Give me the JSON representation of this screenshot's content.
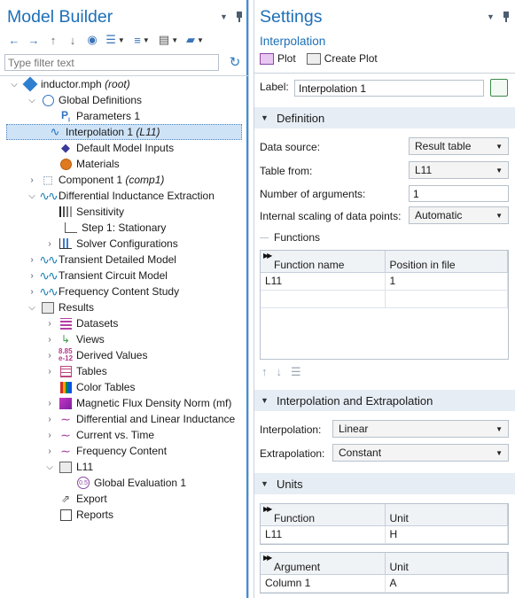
{
  "model_builder": {
    "title": "Model Builder",
    "filter_placeholder": "Type filter text",
    "tree": [
      {
        "label": "inductor.mph",
        "tag": "(root)",
        "icon": "model-root-icon"
      },
      {
        "label": "Global Definitions",
        "icon": "global-definitions-icon"
      },
      {
        "label": "Parameters 1",
        "icon": "parameters-icon"
      },
      {
        "label": "Interpolation 1",
        "tag": "(L11)",
        "icon": "interpolation-icon",
        "selected": true
      },
      {
        "label": "Default Model Inputs",
        "icon": "default-model-inputs-icon"
      },
      {
        "label": "Materials",
        "icon": "materials-icon"
      },
      {
        "label": "Component 1",
        "tag": "(comp1)",
        "icon": "component-icon"
      },
      {
        "label": "Differential Inductance Extraction",
        "icon": "study-icon"
      },
      {
        "label": "Sensitivity",
        "icon": "sensitivity-icon"
      },
      {
        "label": "Step 1: Stationary",
        "icon": "stationary-step-icon"
      },
      {
        "label": "Solver Configurations",
        "icon": "solver-configurations-icon"
      },
      {
        "label": "Transient Detailed Model",
        "icon": "study-icon"
      },
      {
        "label": "Transient Circuit Model",
        "icon": "study-icon"
      },
      {
        "label": "Frequency Content Study",
        "icon": "study-icon"
      },
      {
        "label": "Results",
        "icon": "results-icon"
      },
      {
        "label": "Datasets",
        "icon": "datasets-icon"
      },
      {
        "label": "Views",
        "icon": "views-icon"
      },
      {
        "label": "Derived Values",
        "icon": "derived-values-icon"
      },
      {
        "label": "Tables",
        "icon": "tables-icon"
      },
      {
        "label": "Color Tables",
        "icon": "color-tables-icon"
      },
      {
        "label": "Magnetic Flux Density Norm (mf)",
        "icon": "plot-group-icon"
      },
      {
        "label": "Differential and Linear Inductance",
        "icon": "1d-plot-icon"
      },
      {
        "label": "Current vs. Time",
        "icon": "1d-plot-icon"
      },
      {
        "label": "Frequency Content",
        "icon": "1d-plot-icon"
      },
      {
        "label": "L11",
        "icon": "evaluation-group-icon"
      },
      {
        "label": "Global Evaluation 1",
        "icon": "global-evaluation-icon"
      },
      {
        "label": "Export",
        "icon": "export-icon"
      },
      {
        "label": "Reports",
        "icon": "reports-icon"
      }
    ]
  },
  "settings": {
    "title": "Settings",
    "subtitle": "Interpolation",
    "plot_label": "Plot",
    "create_plot_label": "Create Plot",
    "label_caption": "Label:",
    "label_value": "Interpolation 1",
    "definition": {
      "header": "Definition",
      "data_source_label": "Data source:",
      "data_source_value": "Result table",
      "table_from_label": "Table from:",
      "table_from_value": "L11",
      "num_args_label": "Number of arguments:",
      "num_args_value": "1",
      "scaling_label": "Internal scaling of data points:",
      "scaling_value": "Automatic",
      "functions_group": "Functions",
      "functions_table": {
        "headers": [
          "Function name",
          "Position in file"
        ],
        "rows": [
          [
            "L11",
            "1"
          ],
          [
            "",
            ""
          ]
        ]
      }
    },
    "interp_extrap": {
      "header": "Interpolation and Extrapolation",
      "interpolation_label": "Interpolation:",
      "interpolation_value": "Linear",
      "extrapolation_label": "Extrapolation:",
      "extrapolation_value": "Constant"
    },
    "units": {
      "header": "Units",
      "function_table": {
        "headers": [
          "Function",
          "Unit"
        ],
        "rows": [
          [
            "L11",
            "H"
          ]
        ]
      },
      "argument_table": {
        "headers": [
          "Argument",
          "Unit"
        ],
        "rows": [
          [
            "Column 1",
            "A"
          ]
        ]
      }
    }
  },
  "colors": {
    "accent": "#1d6fb8",
    "selection": "#cfe3f7",
    "section_bg": "#e6edf5"
  }
}
